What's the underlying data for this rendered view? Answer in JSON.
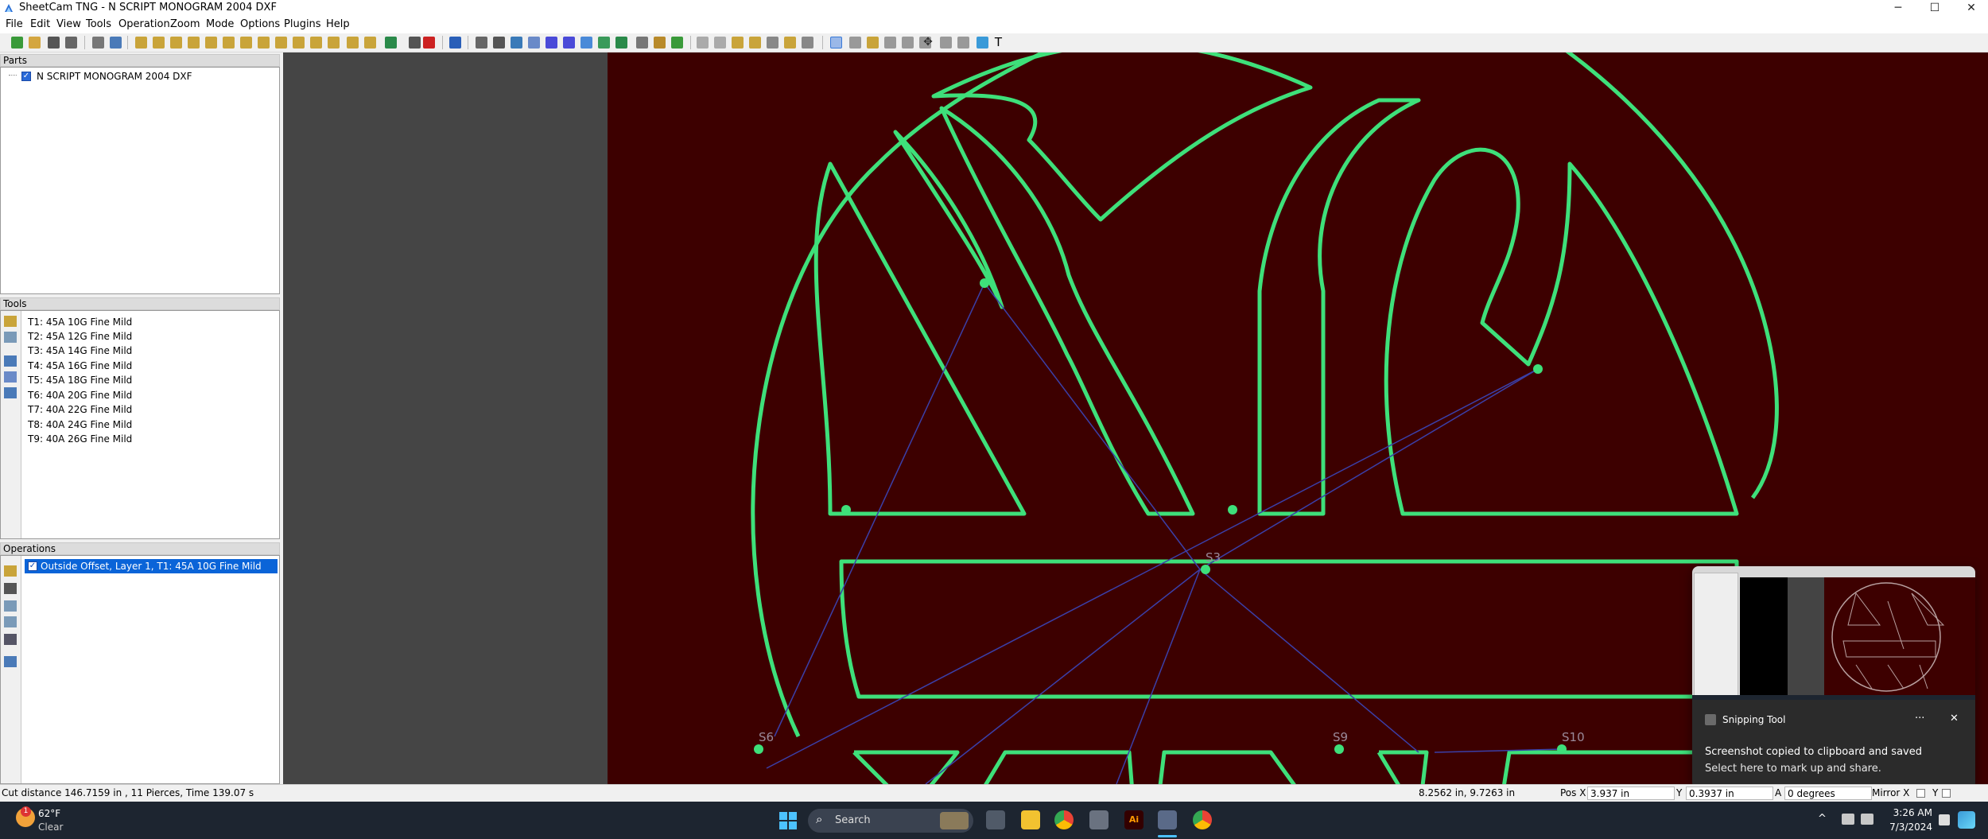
{
  "window": {
    "title": "SheetCam TNG - N SCRIPT MONOGRAM 2004 DXF",
    "controls": [
      "─",
      "☐",
      "✕"
    ]
  },
  "menu": [
    "File",
    "Edit",
    "View",
    "Tools",
    "Operation",
    "Zoom",
    "Mode",
    "Options",
    "Plugins",
    "Help"
  ],
  "parts": {
    "title": "Parts",
    "items": [
      {
        "label": "N SCRIPT MONOGRAM 2004 DXF",
        "checked": true
      }
    ]
  },
  "tools": {
    "title": "Tools",
    "items": [
      "T1: 45A 10G Fine Mild",
      "T2: 45A 12G Fine Mild",
      "T3: 45A 14G Fine Mild",
      "T4: 45A 16G Fine Mild",
      "T5: 45A 18G Fine Mild",
      "T6: 40A 20G Fine Mild",
      "T7: 40A 22G Fine Mild",
      "T8: 40A 24G Fine Mild",
      "T9: 40A 26G Fine Mild"
    ]
  },
  "operations": {
    "title": "Operations",
    "items": [
      {
        "label": "Outside Offset, Layer 1, T1: 45A 10G Fine Mild",
        "checked": true,
        "selected": true
      }
    ]
  },
  "canvas": {
    "labels": [
      "S3",
      "S6",
      "S9",
      "S10"
    ],
    "colors": {
      "background": "#3d0000",
      "outline": "#3ee07a",
      "rapids": "#3b3fa8"
    }
  },
  "status": {
    "cut_info": "Cut distance 146.7159 in , 11 Pierces, Time 139.07 s",
    "cursor": "8.2562 in, 9.7263 in",
    "pos_x_label": "Pos X",
    "pos_x": "3.937 in",
    "y_label": "Y",
    "y_value": "0.3937 in",
    "angle_label": "A",
    "angle_value": "0 degrees",
    "mirror_x": "Mirror X",
    "mirror_y": "Y"
  },
  "toast": {
    "app": "Snipping Tool",
    "heading": "Screenshot copied to clipboard and saved",
    "body": "Select here to mark up and share.",
    "more": "···",
    "close": "✕"
  },
  "taskbar": {
    "weather_temp": "62°F",
    "weather_cond": "Clear",
    "weather_badge": "1",
    "search": "Search",
    "time": "3:26 AM",
    "date": "7/3/2024",
    "tray_arrow": "^"
  }
}
